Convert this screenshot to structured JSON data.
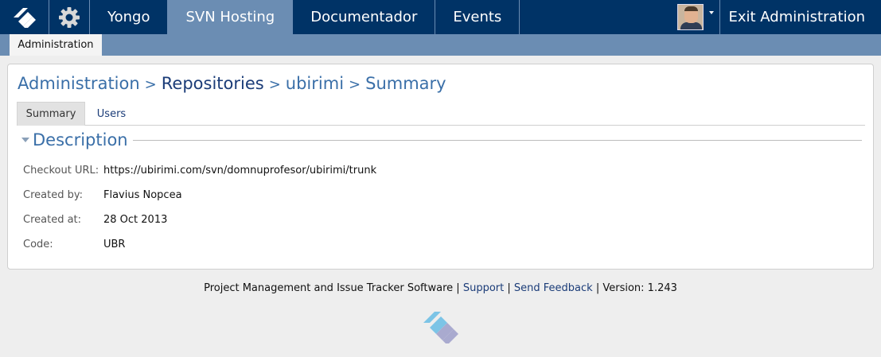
{
  "topbar": {
    "links": [
      "Yongo",
      "SVN Hosting",
      "Documentador",
      "Events"
    ],
    "active": "SVN Hosting",
    "exit_label": "Exit Administration",
    "accent": "#003366"
  },
  "subbar": {
    "tab_label": "Administration"
  },
  "breadcrumb": {
    "items": [
      "Administration",
      "Repositories",
      "ubirimi",
      "Summary"
    ],
    "separator": ">"
  },
  "tabs": [
    "Summary",
    "Users"
  ],
  "section": {
    "title": "Description"
  },
  "fields": [
    {
      "label": "Checkout URL:",
      "value": "https://ubirimi.com/svn/domnuprofesor/ubirimi/trunk"
    },
    {
      "label": "Created by:",
      "value": "Flavius Nopcea"
    },
    {
      "label": "Created at:",
      "value": "28 Oct 2013"
    },
    {
      "label": "Code:",
      "value": "UBR"
    }
  ],
  "footer": {
    "product": "Project Management and Issue Tracker Software",
    "support": "Support",
    "feedback": "Send Feedback",
    "version": "Version: 1.243",
    "divider": "|"
  },
  "icons": {
    "logo": "ubirimi-logo-icon",
    "gear": "gear-icon",
    "caret": "caret-down-icon"
  }
}
